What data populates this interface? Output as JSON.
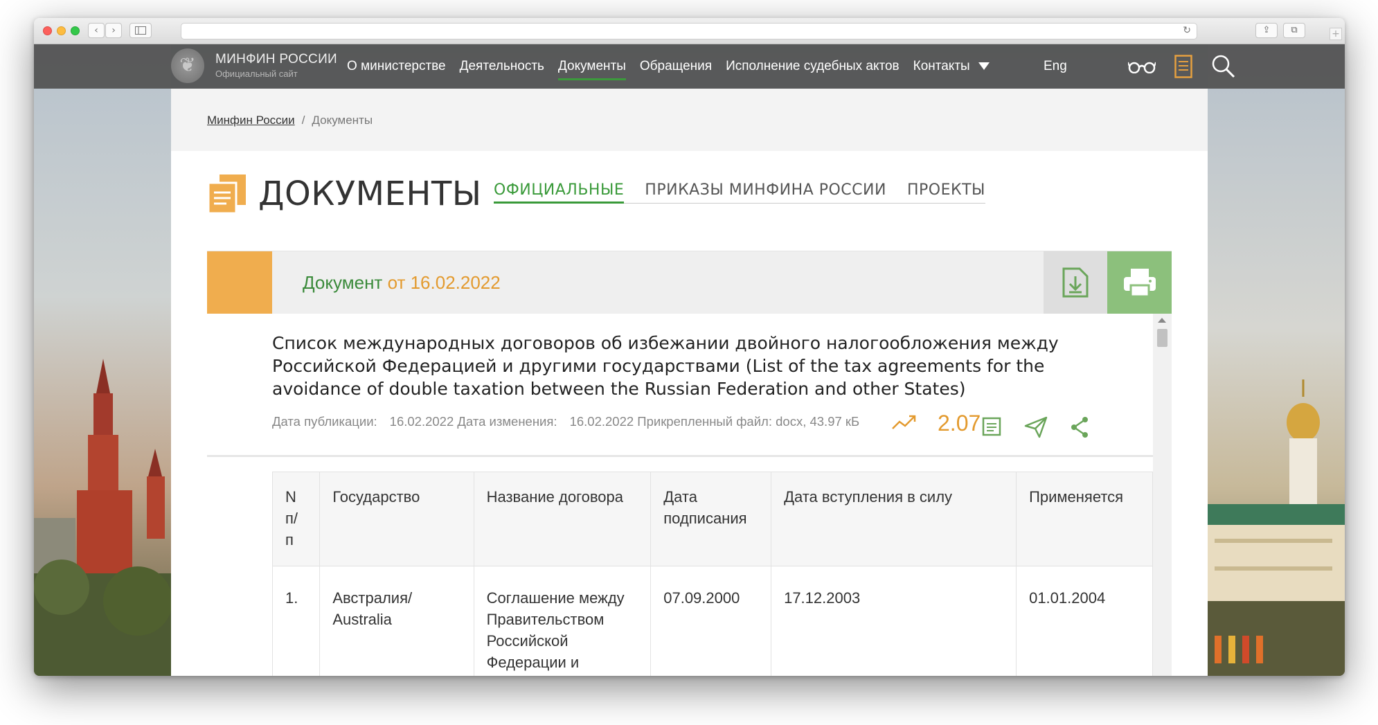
{
  "topnav": {
    "logo_title": "МИНФИН РОССИИ",
    "logo_subtitle": "Официальный сайт",
    "menu": [
      {
        "label": "О министерстве"
      },
      {
        "label": "Деятельность"
      },
      {
        "label": "Документы",
        "active": true
      },
      {
        "label": "Обращения"
      },
      {
        "label": "Исполнение судебных актов"
      },
      {
        "label": "Контакты"
      }
    ],
    "lang": "Eng",
    "icons": [
      "glasses-icon",
      "book-icon",
      "search-icon"
    ]
  },
  "breadcrumb": {
    "home": "Минфин России",
    "separator": "/",
    "current": "Документы"
  },
  "page": {
    "title": "ДОКУМЕНТЫ",
    "tabs": [
      {
        "label": "ОФИЦИАЛЬНЫЕ",
        "active": true
      },
      {
        "label": "ПРИКАЗЫ МИНФИНА РОССИИ"
      },
      {
        "label": "ПРОЕКТЫ"
      }
    ]
  },
  "document": {
    "bar_label": "Документ",
    "bar_date": "от 16.02.2022",
    "title": "Список международных договоров об избежании двойного налогообложения между Российской Федерацией и другими государствами (List of the tax agreements for the avoidance of double taxation between the Russian Federation and other States)",
    "meta": {
      "pub_label": "Дата публикации:",
      "pub_date": "16.02.2022",
      "mod_label": "Дата изменения:",
      "mod_date": "16.02.2022",
      "file_label": "Прикрепленный файл:",
      "file_info": "docx, 43.97 кБ"
    },
    "views": "2.07"
  },
  "table": {
    "headers": [
      "N п/ п",
      "Государство",
      "Название договора",
      "Дата подписания",
      "Дата вступления в силу",
      "Применяется"
    ],
    "rows": [
      [
        "1.",
        "Австралия/ Australia",
        "Соглашение между Правительством Российской Федерации и Правительством",
        "07.09.2000",
        "17.12.2003",
        "01.01.2004"
      ]
    ]
  },
  "colors": {
    "accent_green": "#3a9a3a",
    "accent_orange": "#f0ad4e",
    "print_green": "#8cc07c",
    "nav_bg": "#505050"
  }
}
